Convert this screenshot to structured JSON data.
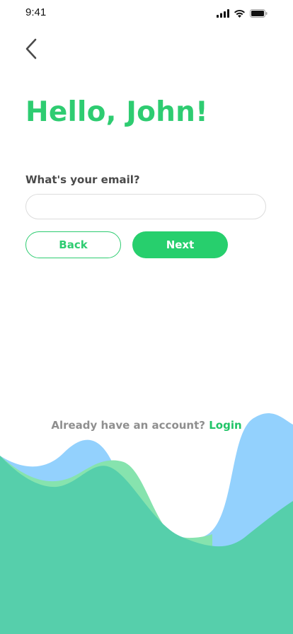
{
  "status_bar": {
    "time": "9:41"
  },
  "header": {
    "back_icon": "chevron-left-icon"
  },
  "main": {
    "greeting": "Hello, John!",
    "email_label": "What's your email?",
    "email_value": "",
    "email_placeholder": "",
    "back_label": "Back",
    "next_label": "Next"
  },
  "footer": {
    "prompt": "Already have an account?",
    "login_label": "Login"
  },
  "colors": {
    "accent": "#2ecc71",
    "wave_blue": "#93d1fd",
    "wave_light_green": "#86e3ae",
    "wave_teal": "#56cfab"
  }
}
